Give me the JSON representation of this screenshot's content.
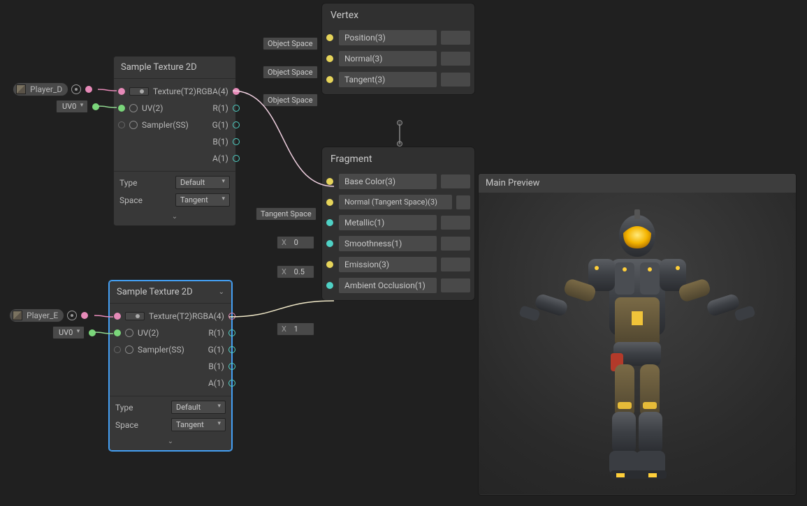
{
  "props": {
    "playerD": {
      "label": "Player_D"
    },
    "playerE": {
      "label": "Player_E"
    },
    "uv": "UV0"
  },
  "sample1": {
    "title": "Sample Texture 2D",
    "in_texture": "Texture(T2)",
    "in_uv": "UV(2)",
    "in_sampler": "Sampler(SS)",
    "out_rgba": "RGBA(4)",
    "out_r": "R(1)",
    "out_g": "G(1)",
    "out_b": "B(1)",
    "out_a": "A(1)",
    "type_label": "Type",
    "type_value": "Default",
    "space_label": "Space",
    "space_value": "Tangent"
  },
  "sample2": {
    "title": "Sample Texture 2D",
    "in_texture": "Texture(T2)",
    "in_uv": "UV(2)",
    "in_sampler": "Sampler(SS)",
    "out_rgba": "RGBA(4)",
    "out_r": "R(1)",
    "out_g": "G(1)",
    "out_b": "B(1)",
    "out_a": "A(1)",
    "type_label": "Type",
    "type_value": "Default",
    "space_label": "Space",
    "space_value": "Tangent"
  },
  "vertex": {
    "title": "Vertex",
    "objspace": "Object Space",
    "position": "Position(3)",
    "normal": "Normal(3)",
    "tangent": "Tangent(3)"
  },
  "fragment": {
    "title": "Fragment",
    "basecolor": "Base Color(3)",
    "tangentspace": "Tangent Space",
    "normal": "Normal (Tangent Space)(3)",
    "metallic": "Metallic(1)",
    "metallic_x": "0",
    "smoothness": "Smoothness(1)",
    "smoothness_x": "0.5",
    "emission": "Emission(3)",
    "ao": "Ambient Occlusion(1)",
    "ao_x": "1",
    "x": "X"
  },
  "preview": {
    "title": "Main Preview"
  }
}
